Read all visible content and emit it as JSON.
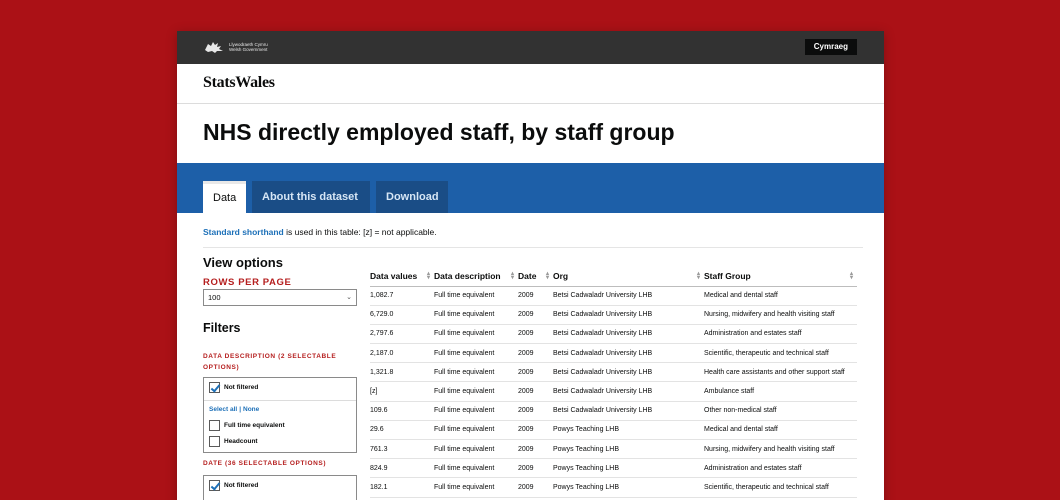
{
  "gov": {
    "logo_lines": [
      "Llywodraeth Cymru",
      "Welsh Government"
    ],
    "language_button": "Cymraeg"
  },
  "brand": "StatsWales",
  "page_title": "NHS directly employed staff, by staff group",
  "tabs": [
    {
      "label": "Data",
      "active": true
    },
    {
      "label": "About this dataset",
      "active": false
    },
    {
      "label": "Download",
      "active": false
    }
  ],
  "shorthand": {
    "link": "Standard shorthand",
    "text": " is used in this table: [z] = not applicable."
  },
  "view_options": {
    "heading": "View options",
    "rows_label": "ROWS PER PAGE",
    "rows_value": "100"
  },
  "filters": {
    "heading": "Filters",
    "groups": [
      {
        "title": "DATA DESCRIPTION (2 SELECTABLE OPTIONS)",
        "not_filtered": "Not filtered",
        "select_all": "Select all",
        "none": "None",
        "options": [
          "Full time equivalent",
          "Headcount"
        ]
      },
      {
        "title": "DATE (36 SELECTABLE OPTIONS)",
        "not_filtered": "Not filtered"
      }
    ]
  },
  "table": {
    "headers": [
      "Data values",
      "Data description",
      "Date",
      "Org",
      "Staff Group"
    ],
    "rows": [
      [
        "1,082.7",
        "Full time equivalent",
        "2009",
        "Betsi Cadwaladr University LHB",
        "Medical and dental staff"
      ],
      [
        "6,729.0",
        "Full time equivalent",
        "2009",
        "Betsi Cadwaladr University LHB",
        "Nursing, midwifery and health visiting staff"
      ],
      [
        "2,797.6",
        "Full time equivalent",
        "2009",
        "Betsi Cadwaladr University LHB",
        "Administration and estates staff"
      ],
      [
        "2,187.0",
        "Full time equivalent",
        "2009",
        "Betsi Cadwaladr University LHB",
        "Scientific, therapeutic and technical staff"
      ],
      [
        "1,321.8",
        "Full time equivalent",
        "2009",
        "Betsi Cadwaladr University LHB",
        "Health care assistants and other support staff"
      ],
      [
        "[z]",
        "Full time equivalent",
        "2009",
        "Betsi Cadwaladr University LHB",
        "Ambulance staff"
      ],
      [
        "109.6",
        "Full time equivalent",
        "2009",
        "Betsi Cadwaladr University LHB",
        "Other non-medical staff"
      ],
      [
        "29.6",
        "Full time equivalent",
        "2009",
        "Powys Teaching LHB",
        "Medical and dental staff"
      ],
      [
        "761.3",
        "Full time equivalent",
        "2009",
        "Powys Teaching LHB",
        "Nursing, midwifery and health visiting staff"
      ],
      [
        "824.9",
        "Full time equivalent",
        "2009",
        "Powys Teaching LHB",
        "Administration and estates staff"
      ],
      [
        "182.1",
        "Full time equivalent",
        "2009",
        "Powys Teaching LHB",
        "Scientific, therapeutic and technical staff"
      ]
    ]
  },
  "colors": {
    "background": "#ab1116",
    "band": "#1d5fa8",
    "link": "#1d70b8",
    "accent_red": "#b51e1e"
  }
}
